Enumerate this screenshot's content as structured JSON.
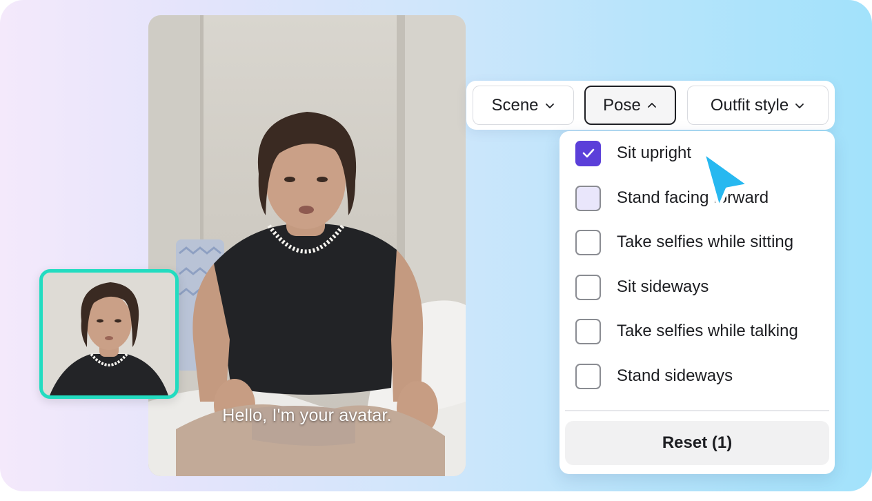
{
  "video": {
    "caption": "Hello, I'm your avatar."
  },
  "toolbar": {
    "scene_label": "Scene",
    "pose_label": "Pose",
    "outfit_label": "Outfit style",
    "active": "Pose"
  },
  "pose_menu": {
    "options": [
      {
        "label": "Sit upright",
        "checked": true
      },
      {
        "label": "Stand facing forward",
        "checked": false
      },
      {
        "label": "Take selfies while sitting",
        "checked": false
      },
      {
        "label": "Sit sideways",
        "checked": false
      },
      {
        "label": "Take selfies while talking",
        "checked": false
      },
      {
        "label": "Stand sideways",
        "checked": false
      }
    ],
    "reset_label": "Reset (1)"
  },
  "colors": {
    "accent": "#5b3fd9",
    "thumbnail_border": "#22dcc0",
    "cursor": "#27b8f0"
  },
  "icons": {
    "chevron_down": "chevron-down-icon",
    "chevron_up": "chevron-up-icon",
    "check": "check-icon",
    "pointer": "pointer-cursor-icon"
  }
}
